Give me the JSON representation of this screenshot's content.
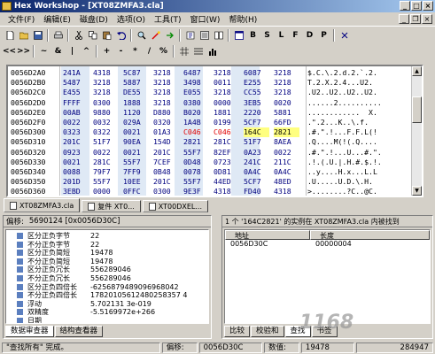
{
  "window": {
    "title": "Hex Workshop - [XT08ZMFA3.cla]"
  },
  "menu": [
    "文件(F)",
    "编辑(E)",
    "磁盘(D)",
    "选项(O)",
    "工具(T)",
    "窗口(W)",
    "帮助(H)"
  ],
  "toolbar": {
    "row1": [
      "new-icon",
      "open-icon",
      "save-icon",
      "print-icon",
      "cut-icon",
      "copy-icon",
      "paste-icon",
      "undo-icon",
      "find-icon",
      "replace-icon",
      "goto-icon",
      "bookmark-icon",
      "checksum-icon",
      "compare-icon",
      "undo-search-icon",
      "window-icon",
      "help-icon"
    ],
    "row1_letters": [
      "B",
      "S",
      "L",
      "F",
      "D",
      "P"
    ],
    "row2_symbols": [
      "<<",
      ">>",
      "~",
      "&",
      "|",
      "^",
      "+",
      "-",
      "*",
      "/",
      "%"
    ]
  },
  "hex": {
    "rows": [
      {
        "addr": "0056D2A0",
        "cells": [
          "241A",
          "4318",
          "5C87",
          "3218",
          "6487",
          "3218",
          "6087",
          "3218"
        ],
        "ascii": "$.C.\\.2.d.2.`.2."
      },
      {
        "addr": "0056D2B0",
        "cells": [
          "5487",
          "3218",
          "5887",
          "3218",
          "3498",
          "0011",
          "E255",
          "3218"
        ],
        "ascii": "T.2.X.2.4...U2."
      },
      {
        "addr": "0056D2C0",
        "cells": [
          "E455",
          "3218",
          "DE55",
          "3218",
          "E055",
          "3218",
          "CC55",
          "3218"
        ],
        "ascii": ".U2..U2..U2..U2."
      },
      {
        "addr": "0056D2D0",
        "cells": [
          "FFFF",
          "0300",
          "1888",
          "3218",
          "0380",
          "0000",
          "3EB5",
          "0020"
        ],
        "ascii": "......2.........."
      },
      {
        "addr": "0056D2E0",
        "cells": [
          "00AB",
          "9880",
          "1120",
          "D880",
          "B020",
          "1881",
          "2220",
          "5881"
        ],
        "ascii": "............  X."
      },
      {
        "addr": "0056D2F0",
        "cells": [
          "0022",
          "0032",
          "029A",
          "0320",
          "1A4B",
          "0199",
          "5CF7",
          "66FD"
        ],
        "ascii": ".\".2...K..\\.f."
      },
      {
        "addr": "0056D300",
        "cells": [
          "0323",
          "0322",
          "0021",
          "01A3",
          "C046",
          "C046",
          "164C",
          "2821"
        ],
        "ascii": ".#.\".!...F.F.L(!"
      },
      {
        "addr": "0056D310",
        "cells": [
          "201C",
          "51F7",
          "90EA",
          "154D",
          "2821",
          "281C",
          "51F7",
          "8AEA"
        ],
        "ascii": ".Q....M(!(.Q...."
      },
      {
        "addr": "0056D320",
        "cells": [
          "0923",
          "0022",
          "0021",
          "201C",
          "55F7",
          "82EF",
          "0A23",
          "0022"
        ],
        "ascii": ".#.\".!...U...#.\"."
      },
      {
        "addr": "0056D330",
        "cells": [
          "0021",
          "281C",
          "55F7",
          "7CEF",
          "0D48",
          "0723",
          "241C",
          "211C"
        ],
        "ascii": ".!.(.U.|.H.#.$.!."
      },
      {
        "addr": "0056D340",
        "cells": [
          "0088",
          "79F7",
          "7FF9",
          "0B48",
          "0078",
          "0D81",
          "0A4C",
          "0A4C"
        ],
        "ascii": "..y....H.x...L.L"
      },
      {
        "addr": "0056D350",
        "cells": [
          "201D",
          "55F7",
          "10EE",
          "201C",
          "55F7",
          "44ED",
          "5CF7",
          "48ED"
        ],
        "ascii": ".U.....U.D.\\.H."
      },
      {
        "addr": "0056D360",
        "cells": [
          "3EBD",
          "0000",
          "0FFC",
          "0300",
          "9E3F",
          "4318",
          "FD40",
          "4318"
        ],
        "ascii": ">........?C..@C."
      }
    ]
  },
  "doc_tabs": [
    "XT08ZMFA3.cla",
    "复件 XT0...",
    "XT00DXEL..."
  ],
  "data_inspector": {
    "header_prefix": "偏移: ",
    "header_value": "5690124 [0x0056D30C]",
    "rows": [
      {
        "label": "区分正负字节",
        "value": "22"
      },
      {
        "label": "不分正负字节",
        "value": "22"
      },
      {
        "label": "区分正负简短",
        "value": "19478"
      },
      {
        "label": "不分正负简短",
        "value": "19478"
      },
      {
        "label": "区分正负冗长",
        "value": "556289046"
      },
      {
        "label": "不分正负冗长",
        "value": "556289046"
      },
      {
        "label": "区分正负四倍长",
        "value": "-6256879489096968042"
      },
      {
        "label": "不分正负四倍长",
        "value": "17820105612480258357 4"
      },
      {
        "label": "浮动",
        "value": "5.702131 3e-019"
      },
      {
        "label": "双精度",
        "value": "-5.5169972e+266"
      },
      {
        "label": "日期",
        "value": ""
      }
    ],
    "tabs": [
      "数据审查器",
      "结构查看器"
    ]
  },
  "find_results": {
    "header": "1 个 '164C2821' 的实例在 XT08ZMFA3.cla 内被找到",
    "columns": [
      "地址",
      "长度"
    ],
    "rows": [
      {
        "addr": "0056D30C",
        "len": "00000004"
      }
    ],
    "tabs": [
      "比较",
      "校验和",
      "查找",
      "书签"
    ]
  },
  "watermark": "1168",
  "status": {
    "message": "\"查找所有\" 完成。",
    "offset_label": "偏移:",
    "offset": "0056D30C",
    "value_label": "数值:",
    "value": "19478",
    "size": "284947"
  }
}
